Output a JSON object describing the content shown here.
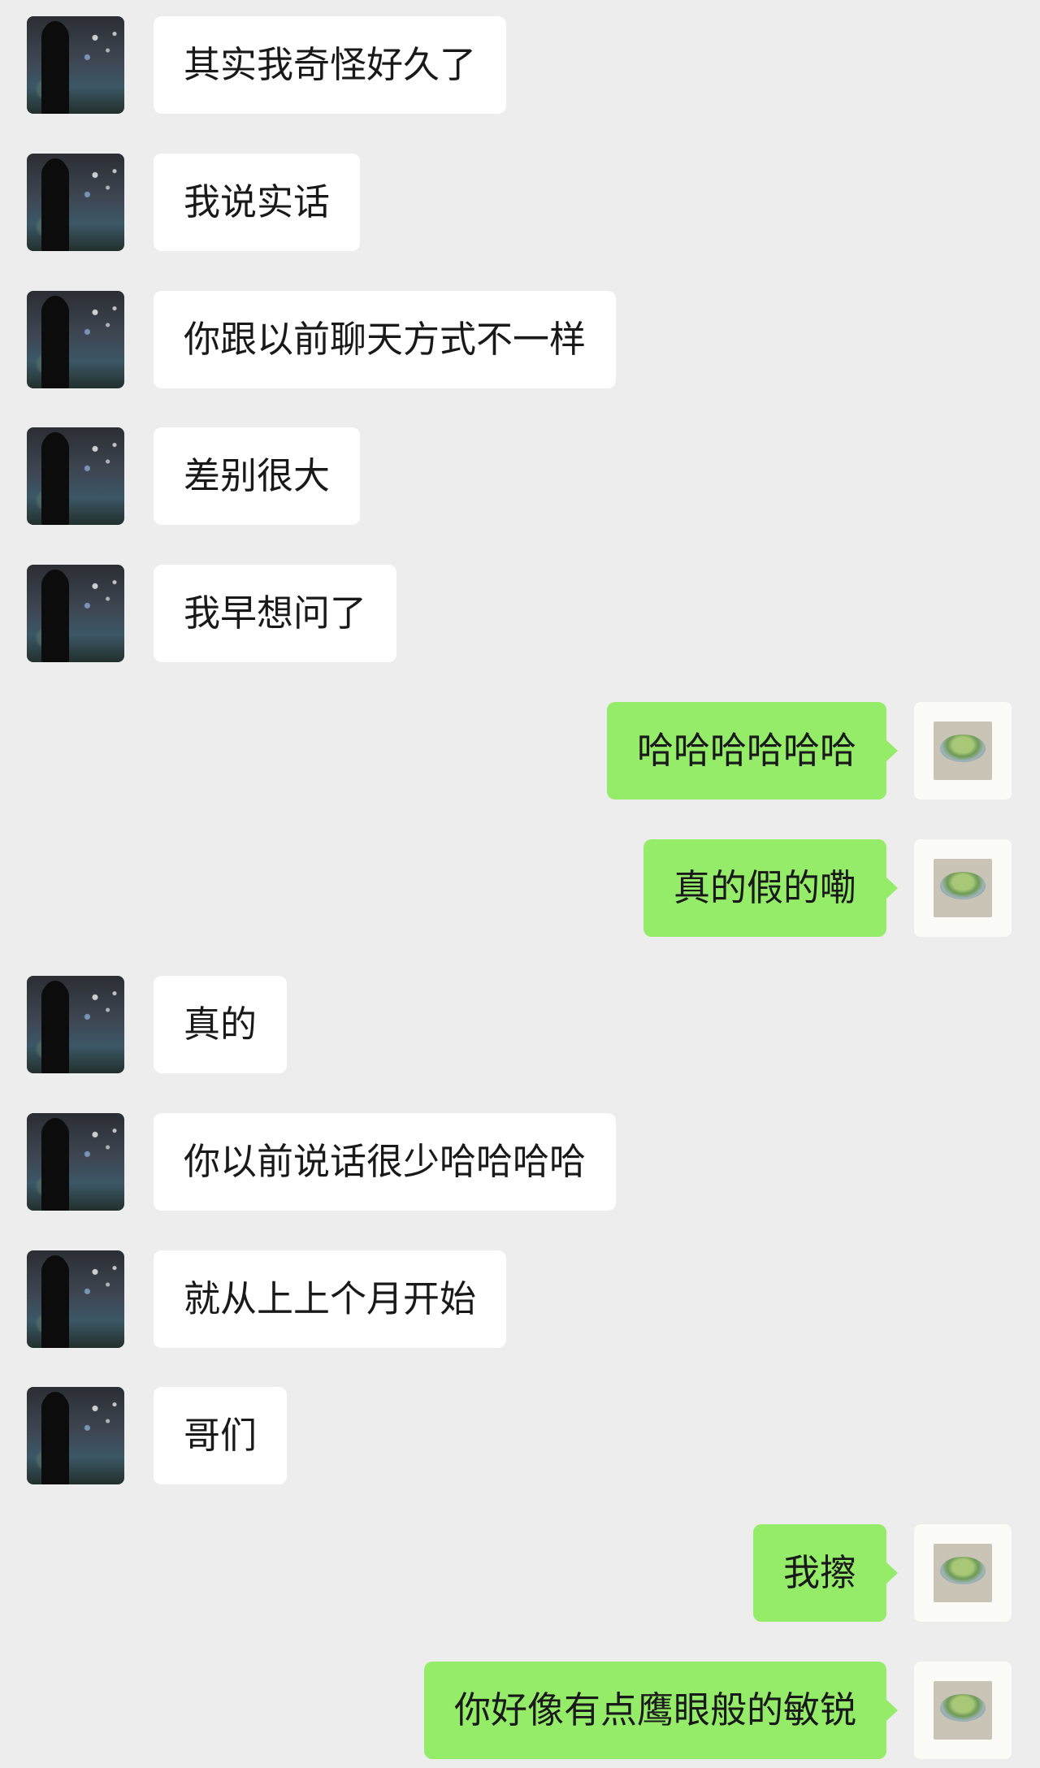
{
  "messages": [
    {
      "side": "left",
      "text": "其实我奇怪好久了"
    },
    {
      "side": "left",
      "text": "我说实话"
    },
    {
      "side": "left",
      "text": "你跟以前聊天方式不一样"
    },
    {
      "side": "left",
      "text": "差别很大"
    },
    {
      "side": "left",
      "text": "我早想问了"
    },
    {
      "side": "right",
      "text": "哈哈哈哈哈哈"
    },
    {
      "side": "right",
      "text": "真的假的嘞"
    },
    {
      "side": "left",
      "text": "真的"
    },
    {
      "side": "left",
      "text": "你以前说话很少哈哈哈哈"
    },
    {
      "side": "left",
      "text": "就从上上个月开始"
    },
    {
      "side": "left",
      "text": "哥们"
    },
    {
      "side": "right",
      "text": "我擦"
    },
    {
      "side": "right",
      "text": "你好像有点鹰眼般的敏锐"
    }
  ],
  "theme": {
    "background_color": "#EDEDED",
    "incoming_bubble_color": "#FFFFFF",
    "outgoing_bubble_color": "#95EC69",
    "text_color": "#191919"
  },
  "avatars": {
    "contact": "night-street-silhouette-avatar",
    "self": "green-bowl-painting-avatar"
  }
}
